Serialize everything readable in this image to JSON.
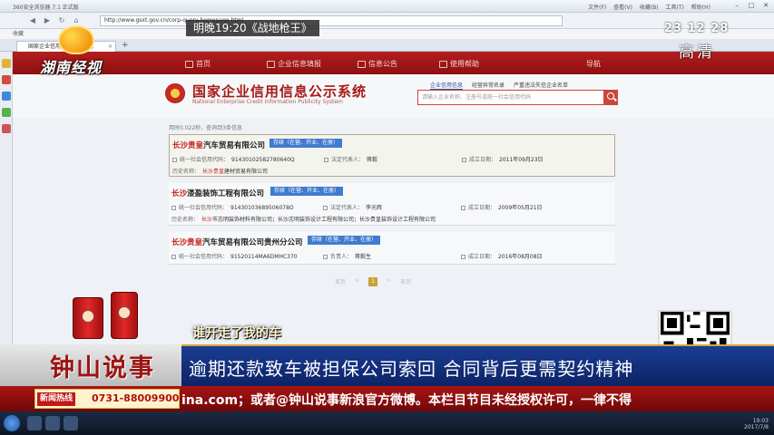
{
  "browser": {
    "window_title": "360安全浏览器 7.1 正式版",
    "menu": "文件(F) 查看(V) 收藏(B) 工具(T) 帮助(H)",
    "address": "http://www.gsxt.gov.cn/corp-query-homepage.html",
    "bookmark": "收藏",
    "tab_label": "国家企业信用信息公示系统"
  },
  "site": {
    "nav": [
      "首页",
      "企业信息填报",
      "信息公告",
      "使用帮助",
      "导航"
    ],
    "logo_cn": "国家企业信用信息公示系统",
    "logo_en": "National Enterprise Credit Information Publicity System",
    "search_tabs": [
      "企业信用信息",
      "经营异常名录",
      "严重违法失信企业名单"
    ],
    "search_placeholder": "请输入企业名称、注册号或统一社会信用代码",
    "results_info": "用时0.022秒，查询到3条信息",
    "results": [
      {
        "name_kw": "长沙贵皇",
        "name_rest": "汽车贸易有限公司",
        "status": "存续（在营、开业、在册）",
        "code_label": "统一社会信用代码：",
        "code": "91430102582780640Q",
        "rep_label": "法定代表人：",
        "rep": "蒋毅",
        "date_label": "成立日期：",
        "date": "2011年09月23日",
        "former_label": "历史名称：",
        "former_kw": "长沙贵皇",
        "former_rest": "建材贸易有限公司"
      },
      {
        "name_kw": "长沙",
        "name_rest": "溇盈装饰工程有限公司",
        "status": "存续（在营、开业、在册）",
        "code_label": "统一社会信用代码：",
        "code": "91430103689506078O",
        "rep_label": "法定代表人：",
        "rep": "李光辉",
        "date_label": "成立日期：",
        "date": "2009年05月21日",
        "former_label": "历史名称：",
        "former_kw": "长沙",
        "former_rest": "市志明装饰材料有限公司；长沙志明装饰设计工程有限公司；长沙贵皇装饰设计工程有限公司"
      },
      {
        "name_kw": "长沙贵皇",
        "name_rest": "汽车贸易有限公司贵州分公司",
        "status": "存续（在营、开业、在册）",
        "code_label": "统一社会信用代码：",
        "code": "91520114MA6DMHC370",
        "rep_label": "负责人：",
        "rep": "蒋毅生",
        "date_label": "成立日期：",
        "date": "2016年08月08日"
      }
    ],
    "pager": {
      "first": "首页",
      "prev": "<",
      "current": "1",
      "next": ">",
      "last": "末页"
    }
  },
  "tv": {
    "channel": "湖南经视",
    "promo": "明晚19:20《战地枪王》",
    "clock": "23 12 28",
    "quality": "高清",
    "teaser": "谁开走了我的车",
    "show_name": "钟山说事",
    "headline": "逾期还款致车被担保公司索回  合同背后更需契约精神",
    "hotline_label": "新闻热线",
    "hotline_number": "0731-88009900",
    "ticker": "ina.com；或者@钟山说事新浪官方微博。本栏目节目未经授权许可，一律不得"
  },
  "taskbar": {
    "time": "19:03",
    "date": "2017/7/8"
  },
  "colors": {
    "site_red": "#b41e1f",
    "keyword_red": "#c8231d",
    "badge_blue": "#3f7ccf",
    "headline_blue": "#1a3d94"
  }
}
